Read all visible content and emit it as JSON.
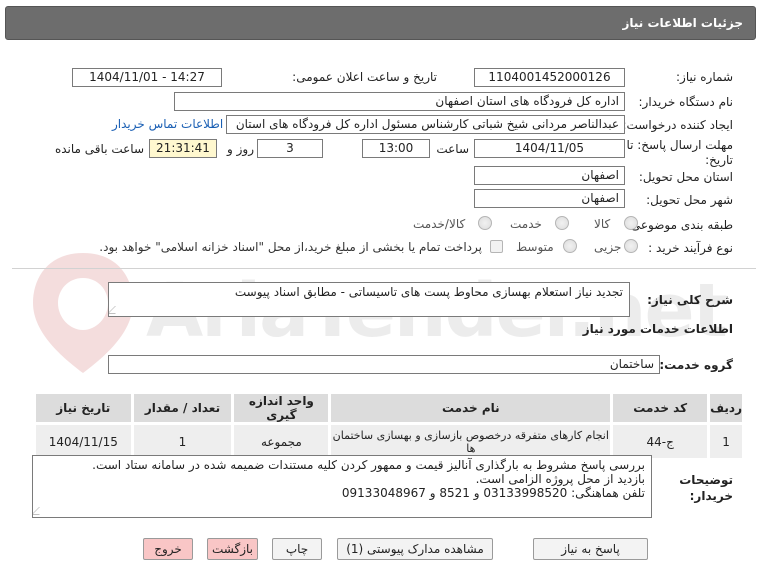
{
  "header": {
    "title": "جزئیات اطلاعات نیاز"
  },
  "fields": {
    "need_number_label": "شماره نیاز:",
    "need_number": "1104001452000126",
    "announce_label": "تاریخ و ساعت اعلان عمومی:",
    "announce_value": "1404/11/01 - 14:27",
    "buyer_label": "نام دستگاه خریدار:",
    "buyer_value": "اداره کل فرودگاه های استان اصفهان",
    "creator_label": "ایجاد کننده درخواست:",
    "creator_value": "عبدالناصر مردانی شیخ شباتی کارشناس مسئول  اداره کل فرودگاه های استان",
    "contact_link": "اطلاعات تماس خریدار",
    "deadline_label_1": "مهلت ارسال پاسخ: تا",
    "deadline_label_2": "تاریخ:",
    "deadline_date": "1404/11/05",
    "time_label": "ساعت",
    "deadline_time": "13:00",
    "days_value": "3",
    "days_label": "روز و",
    "remaining_time": "21:31:41",
    "remaining_label": "ساعت باقی مانده",
    "province_label": "استان محل تحویل:",
    "province_value": "اصفهان",
    "city_label": "شهر محل تحویل:",
    "city_value": "اصفهان",
    "category_label": "طبقه بندی موضوعی:",
    "category_options": [
      "کالا",
      "خدمت",
      "کالا/خدمت"
    ],
    "process_label": "نوع فرآیند خرید :",
    "process_options": [
      "جزیی",
      "متوسط"
    ],
    "process_note": "پرداخت تمام یا بخشی از مبلغ خرید،از محل \"اسناد خزانه اسلامی\" خواهد بود."
  },
  "summary": {
    "label": "شرح کلی نیاز:",
    "value": "تجدید نیاز استعلام بهسازی محاوط پست های تاسیساتی - مطابق اسناد پیوست"
  },
  "services_section_title": "اطلاعات خدمات مورد نیاز",
  "service_group": {
    "label": "گروه خدمت:",
    "value": "ساختمان"
  },
  "table": {
    "headers": [
      "ردیف",
      "کد خدمت",
      "نام خدمت",
      "واحد اندازه گیری",
      "تعداد / مقدار",
      "تاریخ نیاز"
    ],
    "rows": [
      [
        "1",
        "ج-44",
        "انجام کارهای متفرقه درخصوص بازسازی و بهسازی ساختمان ها",
        "مجموعه",
        "1",
        "1404/11/15"
      ]
    ]
  },
  "notes": {
    "label_1": "توضیحات",
    "label_2": "خریدار:",
    "lines": [
      "بررسی پاسخ مشروط  به بارگذاری آنالیز قیمت و ممهور کردن کلیه مستندات ضمیمه شده در سامانه  ستاد است.",
      "بازدید از محل پروژه الزامی است.",
      "تلفن هماهنگی: 03133998520 و 8521  و 09133048967"
    ]
  },
  "buttons": {
    "reply": "پاسخ به نیاز",
    "docs": "مشاهده مدارک پیوستی (1)",
    "print": "چاپ",
    "back": "بازگشت",
    "exit": "خروج"
  },
  "watermark": {
    "text": "AriaTender.net"
  },
  "colors": {
    "header_bg": "#6d6d6d",
    "link": "#1a5fb4",
    "yellow_box": "#fff8cf",
    "exit_button": "#f9c6c6"
  }
}
